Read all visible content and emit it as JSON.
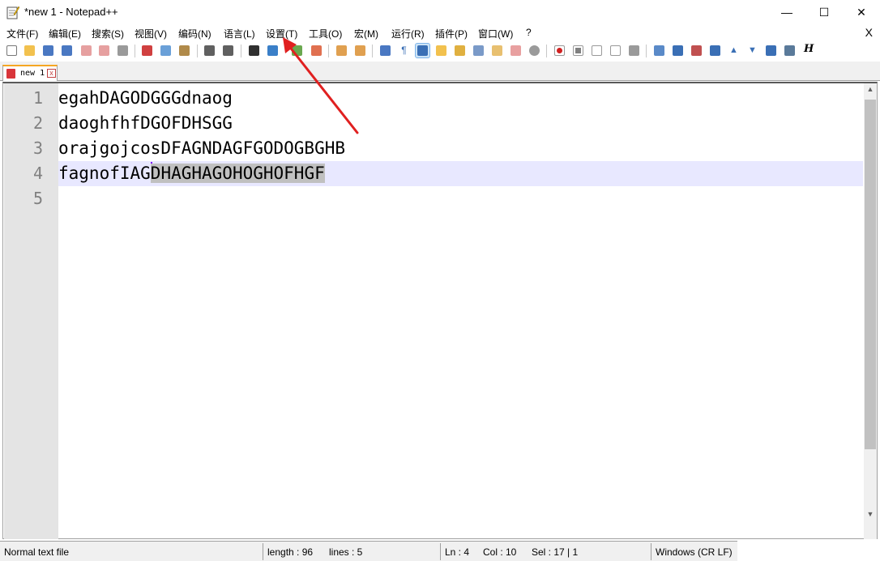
{
  "window": {
    "title": "*new 1 - Notepad++",
    "minimize_glyph": "—",
    "maximize_glyph": "☐",
    "close_glyph": "✕"
  },
  "menu": {
    "items": [
      {
        "label": "文件(F)"
      },
      {
        "label": "编辑(E)"
      },
      {
        "label": "搜索(S)"
      },
      {
        "label": "视图(V)"
      },
      {
        "label": "编码(N)"
      },
      {
        "label": "语言(L)"
      },
      {
        "label": "设置(T)"
      },
      {
        "label": "工具(O)"
      },
      {
        "label": "宏(M)"
      },
      {
        "label": "运行(R)"
      },
      {
        "label": "插件(P)"
      },
      {
        "label": "窗口(W)"
      },
      {
        "label": "?"
      }
    ],
    "close_glyph": "X"
  },
  "toolbar": {
    "last_label": "H"
  },
  "tabs": [
    {
      "label": "new 1",
      "close_glyph": "x"
    }
  ],
  "editor": {
    "lines": [
      {
        "number": "1",
        "text": "egahDAGODGGGdnaog"
      },
      {
        "number": "2",
        "text": "daoghfhfDGOFDHSGG"
      },
      {
        "number": "3",
        "text": "orajgojcosDFAGNDAGFGODOGBGHB"
      },
      {
        "number": "4",
        "text_before": "fagnofIAG",
        "text_selected": "DHAGHAGOHOGHOFHGF"
      },
      {
        "number": "5",
        "text": ""
      }
    ]
  },
  "status": {
    "file_type": "Normal text file",
    "length": "length : 96",
    "lines": "lines : 5",
    "ln": "Ln : 4",
    "col": "Col : 10",
    "sel": "Sel : 17 | 1",
    "eol": "Windows (CR LF)"
  },
  "colors": {
    "arrow": "#e02020",
    "current_line": "#e8e8ff",
    "selection": "#c0c0c0",
    "tab_accent": "#f5a623"
  }
}
